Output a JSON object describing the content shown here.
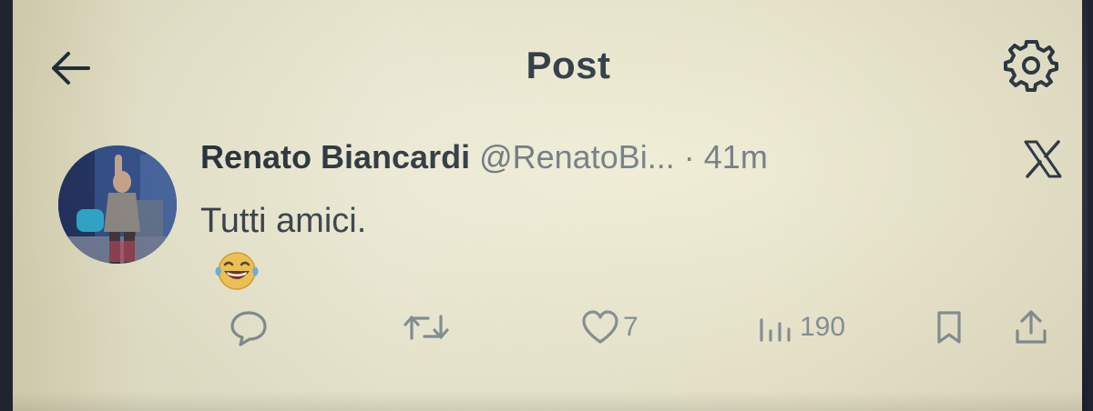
{
  "header": {
    "title": "Post",
    "back_icon": "arrow-left-icon",
    "settings_icon": "gear-icon"
  },
  "post": {
    "author_name": "Renato Biancardi",
    "author_handle": "@RenatoBi...",
    "separator": "·",
    "time": "41m",
    "text": "Tutti amici.",
    "emoji": "face-with-tears-of-joy",
    "platform_icon": "x-logo-icon"
  },
  "actions": {
    "reply": {
      "icon": "comment-icon",
      "count": ""
    },
    "repost": {
      "icon": "repost-icon",
      "count": ""
    },
    "like": {
      "icon": "heart-icon",
      "count": "7"
    },
    "views": {
      "icon": "bar-chart-icon",
      "count": "190"
    },
    "bookmark": {
      "icon": "bookmark-icon"
    },
    "share": {
      "icon": "share-icon"
    }
  },
  "colors": {
    "text_primary": "#1b2630",
    "text_secondary": "#5d6a73",
    "icon_muted": "#7f8a90",
    "screen_background": "#ebe8cf"
  }
}
